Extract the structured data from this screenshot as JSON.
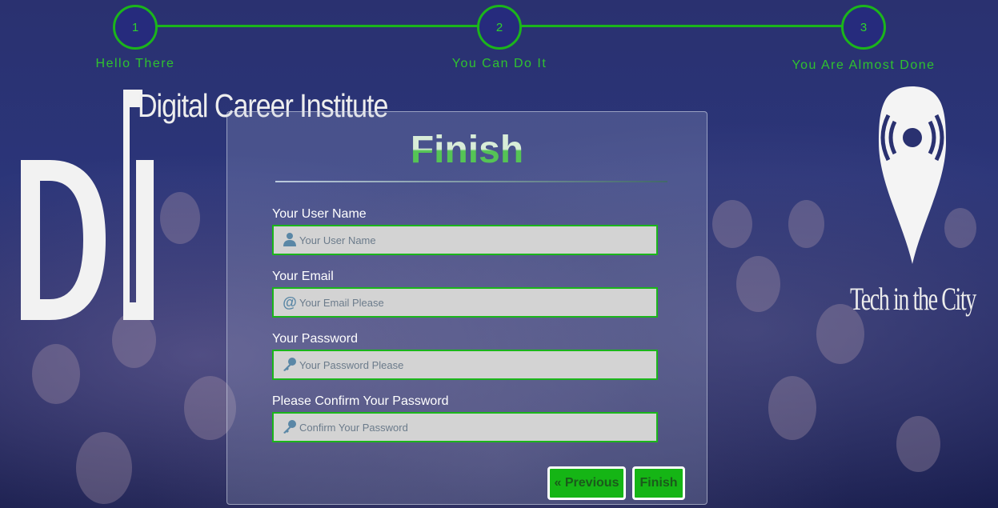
{
  "steps": [
    {
      "number": "1",
      "label": "Hello There"
    },
    {
      "number": "2",
      "label": "You Can Do It"
    },
    {
      "number": "3",
      "label": "You Are Almost Done"
    }
  ],
  "logos": {
    "left_text": "Digital Career Institute",
    "right_text": "Tech in the City"
  },
  "form": {
    "title": "Finish",
    "fields": [
      {
        "label": "Your User Name",
        "placeholder": "Your User Name",
        "icon": "user-icon"
      },
      {
        "label": "Your Email",
        "placeholder": "Your Email Please",
        "icon": "at-icon"
      },
      {
        "label": "Your Password",
        "placeholder": "Your Password Please",
        "icon": "key-icon"
      },
      {
        "label": "Please Confirm Your Password",
        "placeholder": "Confirm Your Password",
        "icon": "key-icon"
      }
    ],
    "previous_label": "« Previous",
    "finish_label": "Finish"
  },
  "colors": {
    "accent_green": "#1bb51b",
    "step_fill": "#262b7d",
    "background": "#2a3170",
    "field_bg": "#d3d3d3"
  }
}
